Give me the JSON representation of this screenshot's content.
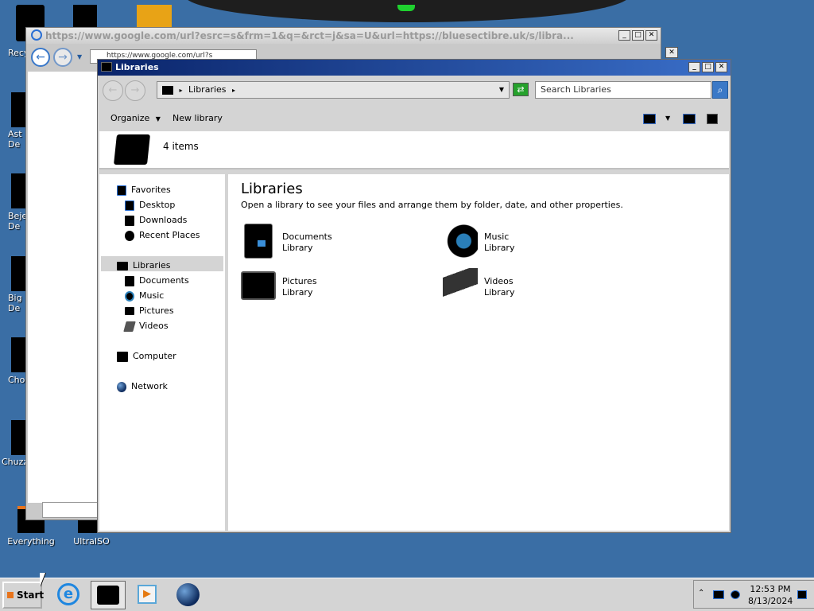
{
  "desktop": {
    "edge_labels": [
      "Recy",
      "Ast\nDe",
      "Beje\nDe",
      "Big I\nDe",
      "Cho",
      "Chuzz"
    ],
    "icons": [
      {
        "label": "Everything"
      },
      {
        "label": "UltraISO"
      }
    ]
  },
  "browser": {
    "title_url": "https://www.google.com/url?esrc=s&frm=1&q=&rct=j&sa=U&url=https://bluesectibre.uk/s/libra...",
    "address_text": "https://www.google.com/url?s"
  },
  "explorer": {
    "window_title": "Libraries",
    "breadcrumb": "Libraries",
    "search_placeholder": "Search Libraries",
    "toolbar": {
      "organize": "Organize",
      "new_library": "New library"
    },
    "item_count": "4 items",
    "heading": "Libraries",
    "description": "Open a library to see your files and arrange them by folder, date, and other properties.",
    "nav": {
      "favorites": "Favorites",
      "desktop": "Desktop",
      "downloads": "Downloads",
      "recent_places": "Recent Places",
      "libraries": "Libraries",
      "documents": "Documents",
      "music": "Music",
      "pictures": "Pictures",
      "videos": "Videos",
      "computer": "Computer",
      "network": "Network"
    },
    "libraries": [
      {
        "name": "Documents",
        "type": "Library",
        "icon": "documents-library-icon"
      },
      {
        "name": "Music",
        "type": "Library",
        "icon": "music-library-icon"
      },
      {
        "name": "Pictures",
        "type": "Library",
        "icon": "pictures-library-icon"
      },
      {
        "name": "Videos",
        "type": "Library",
        "icon": "videos-library-icon"
      }
    ]
  },
  "taskbar": {
    "start_label": "Start",
    "time": "12:53 PM",
    "date": "8/13/2024"
  },
  "colors": {
    "desktop": "#3a6ea5",
    "title_bar": "#0a246a",
    "accent": "#3a6fc9"
  }
}
